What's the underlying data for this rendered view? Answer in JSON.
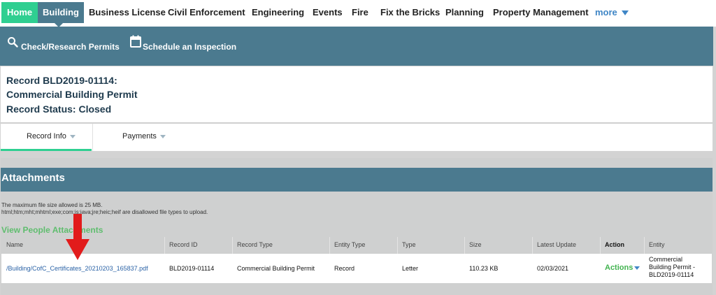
{
  "nav": {
    "home": "Home",
    "building": "Building",
    "business_license": "Business License",
    "civil_enforcement": "Civil Enforcement",
    "engineering": "Engineering",
    "events": "Events",
    "fire": "Fire",
    "fix_the_bricks": "Fix the Bricks",
    "planning": "Planning",
    "property_management": "Property Management",
    "more": "more"
  },
  "subnav": {
    "check_permits": "Check/Research Permits",
    "schedule_inspection": "Schedule an Inspection"
  },
  "record": {
    "line1": "Record BLD2019-01114:",
    "line2": "Commercial Building Permit",
    "line3": "Record Status: Closed"
  },
  "tabs": {
    "record_info": "Record Info",
    "payments": "Payments"
  },
  "attachments": {
    "title": "Attachments",
    "note_size": "The maximum file size allowed is 25 MB.",
    "note_types": "html;htm;mht;mhtml;exe;com;js;java;jre;heic;heif are disallowed file types to upload.",
    "view_people": "View People Attachments",
    "headers": {
      "name": "Name",
      "record_id": "Record ID",
      "record_type": "Record Type",
      "entity_type": "Entity Type",
      "type": "Type",
      "size": "Size",
      "latest_update": "Latest Update",
      "action": "Action",
      "entity": "Entity"
    },
    "row": {
      "name": "/Building/CofC_Certificates_20210203_165837.pdf",
      "record_id": "BLD2019-01114",
      "record_type": "Commercial Building Permit",
      "entity_type": "Record",
      "type": "Letter",
      "size": "110.23 KB",
      "latest_update": "02/03/2021",
      "action": "Actions",
      "entity_line1": "Commercial",
      "entity_line2": "Building Permit -",
      "entity_line3": "BLD2019-01114"
    }
  },
  "colors": {
    "accent": "#4b7a8f",
    "home": "#2fcf91",
    "arrow": "#e21b1b",
    "link": "#2a62a6",
    "green_text": "#5fbd6e"
  },
  "icons": {
    "search": "search-icon",
    "calendar": "calendar-icon",
    "annotation": "red-arrow-annotation"
  }
}
